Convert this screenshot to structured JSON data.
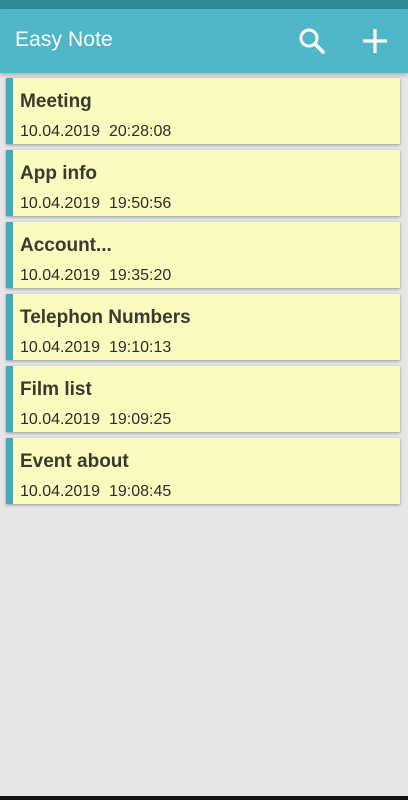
{
  "app": {
    "title": "Easy Note"
  },
  "toolbar": {
    "search_icon": "search-icon",
    "add_icon": "plus-icon"
  },
  "colors": {
    "app_bar": "#4fb7c8",
    "status_bar": "#2f8a98",
    "card_background": "#fafbbe",
    "card_accent": "#3faab9",
    "page_background": "#e6e6e6"
  },
  "notes": [
    {
      "title": "Meeting",
      "date": "10.04.2019  20:28:08"
    },
    {
      "title": "App info",
      "date": "10.04.2019  19:50:56"
    },
    {
      "title": "Account...",
      "date": "10.04.2019  19:35:20"
    },
    {
      "title": "Telephon Numbers",
      "date": "10.04.2019  19:10:13"
    },
    {
      "title": "Film list",
      "date": "10.04.2019  19:09:25"
    },
    {
      "title": "Event about",
      "date": "10.04.2019  19:08:45"
    }
  ]
}
